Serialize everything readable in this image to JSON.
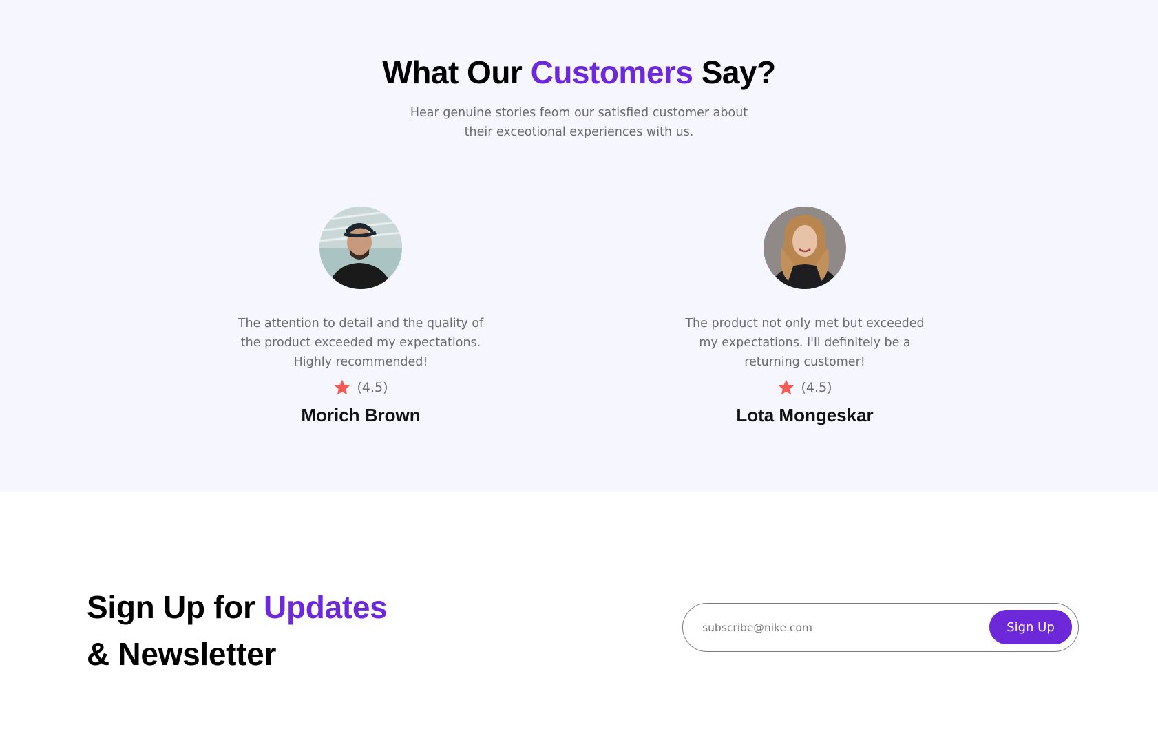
{
  "reviews": {
    "title_before": "What Our",
    "title_accent": "Customers",
    "title_after": "Say?",
    "subtitle_line1": "Hear genuine stories feom our satisfied customer about",
    "subtitle_line2": "their exceotional experiences with us.",
    "cards": [
      {
        "quote_line1": "The attention to detail and the quality of",
        "quote_line2": "the product exceeded my expectations.",
        "quote_line3": "Highly recommended!",
        "rating_text": "(4.5)",
        "rating": 4.5,
        "name": "Morich Brown",
        "avatar_icon": "man-portrait"
      },
      {
        "quote_line1": "The product not only met but exceeded",
        "quote_line2": "my expectations. I'll definitely be a",
        "quote_line3": "returning customer!",
        "rating_text": "(4.5)",
        "rating": 4.5,
        "name": "Lota Mongeskar",
        "avatar_icon": "woman-portrait"
      }
    ]
  },
  "newsletter": {
    "title_before": "Sign Up for",
    "title_accent": "Updates",
    "title_line2": "& Newsletter",
    "input_placeholder": "subscribe@nike.com",
    "input_value": "",
    "button_label": "Sign Up"
  },
  "colors": {
    "accent": "#6d28d9",
    "star": "#f25c54",
    "section_bg": "#f5f6ff"
  }
}
